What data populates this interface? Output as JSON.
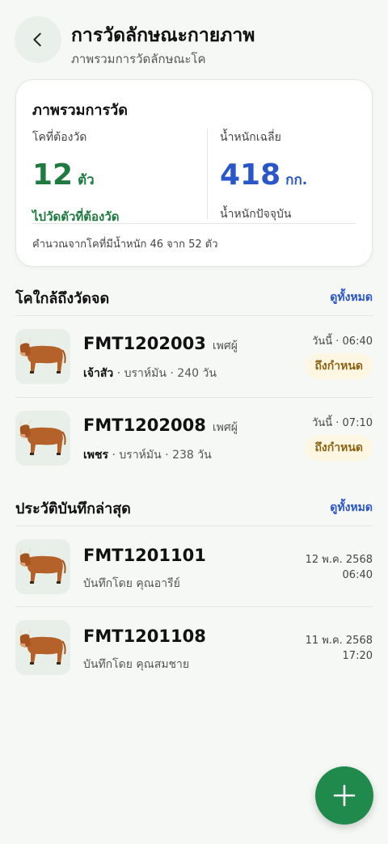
{
  "header": {
    "title": "การวัดลักษณะกายภาพ",
    "subtitle": "ภาพรวมการวัดลักษณะโค"
  },
  "summary": {
    "title": "ภาพรวมการวัด",
    "pending_label": "โคที่ต้องวัด",
    "pending_value": "12",
    "pending_unit": "ตัว",
    "pending_link": "ไปวัดตัวที่ต้องวัด",
    "avg_label": "น้ำหนักเฉลี่ย",
    "avg_value": "418",
    "avg_unit": "กก.",
    "avg_note": "น้ำหนักปัจจุบัน",
    "footer": "คำนวณจากโคที่มีน้ำหนัก 46 จาก 52 ตัว"
  },
  "upcoming": {
    "title": "โคใกล้ถึงวัดจด",
    "see_all": "ดูทั้งหมด",
    "items": [
      {
        "id": "FMT1202003",
        "sex": "เพศผู้",
        "name": "เจ้าสัว",
        "breed": "บราห์มัน",
        "age": "240 วัน",
        "time": "วันนี้ · 06:40",
        "badge": "ถึงกำหนด"
      },
      {
        "id": "FMT1202008",
        "sex": "เพศผู้",
        "name": "เพชร",
        "breed": "บราห์มัน",
        "age": "238 วัน",
        "time": "วันนี้ · 07:10",
        "badge": "ถึงกำหนด"
      }
    ]
  },
  "history": {
    "title": "ประวัติบันทึกล่าสุด",
    "see_all": "ดูทั้งหมด",
    "items": [
      {
        "id": "FMT1201101",
        "recorder": "บันทึกโดย คุณอารีย์",
        "date": "12 พ.ค. 2568",
        "time": "06:40"
      },
      {
        "id": "FMT1201108",
        "recorder": "บันทึกโดย คุณสมชาย",
        "date": "11 พ.ค. 2568",
        "time": "17:20"
      }
    ]
  },
  "icons": {
    "back": "chevron-left-icon",
    "add": "plus-icon",
    "cow": "cow-icon"
  },
  "colors": {
    "primary_green": "#1f8a4c",
    "accent_blue": "#2a56c9",
    "badge_bg": "#fdf6e3",
    "badge_text": "#8a6410"
  }
}
